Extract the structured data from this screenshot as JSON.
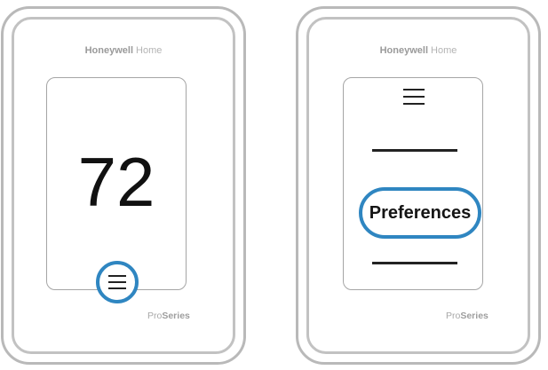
{
  "brand": {
    "name_strong": "Honeywell",
    "name_light": " Home"
  },
  "series": {
    "name_light": "Pro",
    "name_strong": "Series"
  },
  "thermostat_home": {
    "temperature": "72",
    "menu_icon": "hamburger-menu-icon",
    "highlight_color": "#2f86c1"
  },
  "thermostat_menu": {
    "menu_icon": "hamburger-menu-icon",
    "highlighted_item": "Preferences",
    "highlight_color": "#2f86c1"
  }
}
